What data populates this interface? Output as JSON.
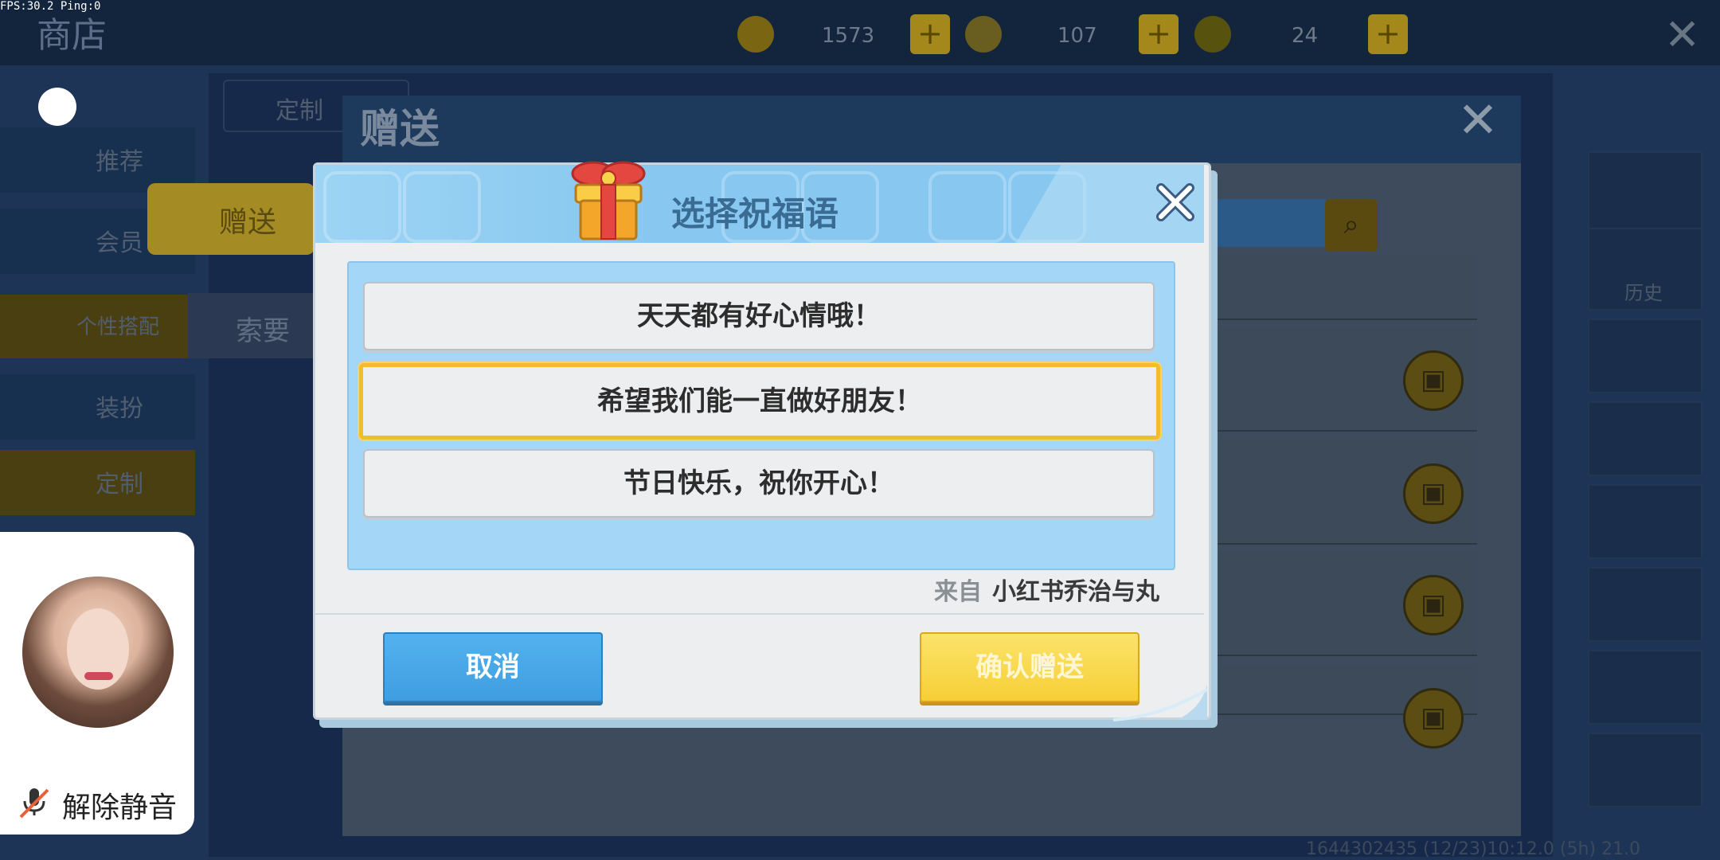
{
  "overlay": {
    "fps_text": "FPS:30.2  Ping:0"
  },
  "shop": {
    "title": "商店",
    "currency": [
      {
        "icon": "coin-icon",
        "amount": "1573"
      },
      {
        "icon": "star-coin-icon",
        "amount": "107"
      },
      {
        "icon": "lightning-icon",
        "amount": "24"
      }
    ],
    "nav_items": [
      "推荐",
      "会员",
      "个性搭配",
      "装扮",
      "定制"
    ],
    "side_tabs": {
      "gift": "赠送",
      "request": "索要"
    },
    "category_tab": "定制",
    "right_history_label": "历史",
    "uid_text": "1644302435  (12/23)10:12.0   (5h) 21.0"
  },
  "gift_dialog": {
    "title": "赠送",
    "search_icon": "search-icon"
  },
  "modal": {
    "title": "选择祝福语",
    "options": [
      "天天都有好心情哦！",
      "希望我们能一直做好朋友！",
      "节日快乐，祝你开心！"
    ],
    "selected_index": 1,
    "from_label": "来自",
    "from_name": "小红书乔治与丸",
    "cancel_label": "取消",
    "confirm_label": "确认赠送"
  },
  "avatar_card": {
    "mute_label": "解除静音"
  },
  "colors": {
    "accent_blue": "#3f9ee0",
    "accent_yellow": "#f6cf35",
    "selected_border": "#f2bd2c",
    "header_blue": "#87c7f0"
  }
}
